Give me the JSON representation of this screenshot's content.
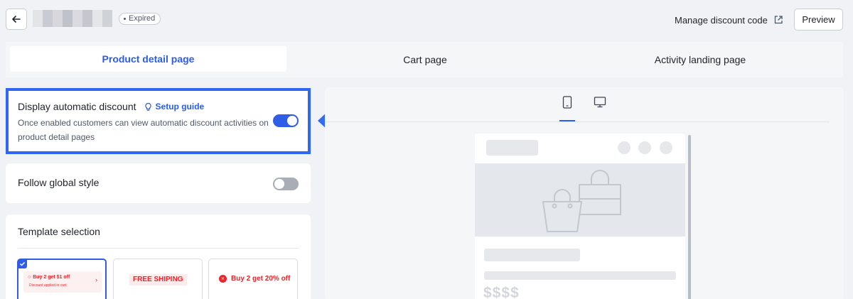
{
  "header": {
    "status_badge": "Expired",
    "manage_link": "Manage discount code",
    "preview_label": "Preview"
  },
  "tabs": [
    {
      "label": "Product detail page",
      "active": true
    },
    {
      "label": "Cart page",
      "active": false
    },
    {
      "label": "Activity landing page",
      "active": false
    }
  ],
  "settings": {
    "auto_discount": {
      "title": "Display automatic discount",
      "guide_label": "Setup guide",
      "description": "Once enabled customers can view automatic discount activities on product detail pages",
      "enabled": true
    },
    "global_style": {
      "title": "Follow global style",
      "enabled": false
    }
  },
  "template_selection": {
    "title": "Template selection",
    "options": [
      {
        "label": "Buy 2 get $1 off",
        "sublabel": "Discount applied in cart",
        "selected": true
      },
      {
        "label": "FREE SHIPING",
        "selected": false
      },
      {
        "label": "Buy 2 get 20% off",
        "selected": false
      }
    ]
  },
  "preview": {
    "device_tabs": [
      "mobile-icon",
      "desktop-icon"
    ],
    "active_device": "mobile",
    "price_placeholder": "$$$$"
  },
  "colors": {
    "accent": "#2f5de8",
    "highlight_border": "#2f66f3",
    "promo_red": "#e8262c",
    "background": "#f1f2f5"
  }
}
